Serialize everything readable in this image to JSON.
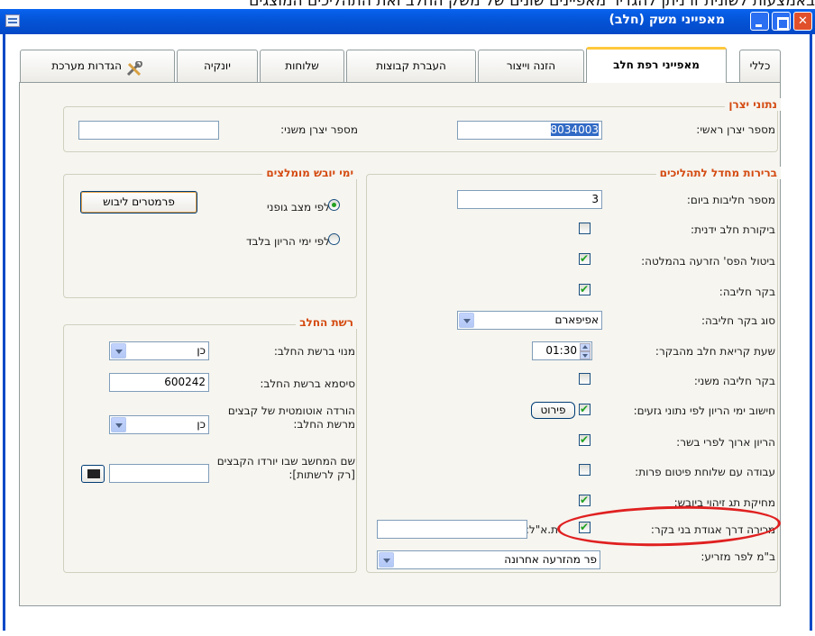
{
  "top_strip_text": "באמצעות לשונית זו ניתן להגדיר מאפיינים שונים של משק החלב ואת התהליכים המוצגים",
  "window": {
    "title": "מאפייני משק (חלב)",
    "buttons": {
      "close": "✕"
    }
  },
  "tabs": [
    "כללי",
    "מאפייני רפת חלב",
    "הזנה וייצור",
    "העברת קבוצות",
    "שלוחות",
    "יונקיה",
    "הגדרות מערכת"
  ],
  "producer": {
    "legend": "נתוני יצרן",
    "main_label": "מספר יצרן ראשי:",
    "main_value": "8034003",
    "secondary_label": "מספר יצרן משני:",
    "secondary_value": ""
  },
  "defaults": {
    "legend": "ברירות מחדל לתהליכים",
    "milkings_label": "מספר חליבות ביום:",
    "milkings_value": "3",
    "manual_check_label": "ביקורת חלב ידנית:",
    "manual_check": false,
    "cancel_insem_label": "ביטול הפס' הזרעה בהמלטה:",
    "cancel_insem": true,
    "milking_ctrl_label": "בקר חליבה:",
    "milking_ctrl": true,
    "ctrl_type_label": "סוג בקר חליבה:",
    "ctrl_type_value": "אפיפארם",
    "read_time_label": "שעת קריאת חלב מהבקר:",
    "read_time_value": "01:30",
    "secondary_ctrl_label": "בקר חליבה משני:",
    "secondary_ctrl": false,
    "calc_days_label": "חישוב ימי הריון לפי נתוני גזעים:",
    "calc_days": true,
    "details_button": "פירוט",
    "long_preg_label": "הריון ארוך לפרי בשר:",
    "long_preg": true,
    "fattening_label": "עבודה עם שלוחת פיטום פרות:",
    "fattening": false,
    "delete_tag_label": "מחיקת תג זיהוי ביובש:",
    "delete_tag": true,
    "sale_label": "מכירה דרך אגודת בני בקר:",
    "sale": true,
    "id_label": "ת.א\"ל:",
    "id_value": "",
    "count_label": "ב\"מ לפר מזריע:",
    "count_value": "פר מהזרעה אחרונה"
  },
  "dry_days": {
    "legend": "ימי יובש מומלצים",
    "button": "פרמטרים ליבוש",
    "option1": "לפי מצב גופני",
    "option1_selected": true,
    "option2": "לפי ימי הריון בלבד",
    "option2_selected": false
  },
  "milk_network": {
    "legend": "רשת החלב",
    "subscribed_label": "מנוי ברשת החלב:",
    "subscribed_value": "כן",
    "password_label": "סיסמא ברשת החלב:",
    "password_value": "600242",
    "auto_download_label": "הורדה אוטומטית של קבצים מרשת החלב:",
    "auto_download_value": "כן",
    "computer_label": "שם המחשב שבו יורדו הקבצים [רק לרשתות]:",
    "computer_value": ""
  }
}
